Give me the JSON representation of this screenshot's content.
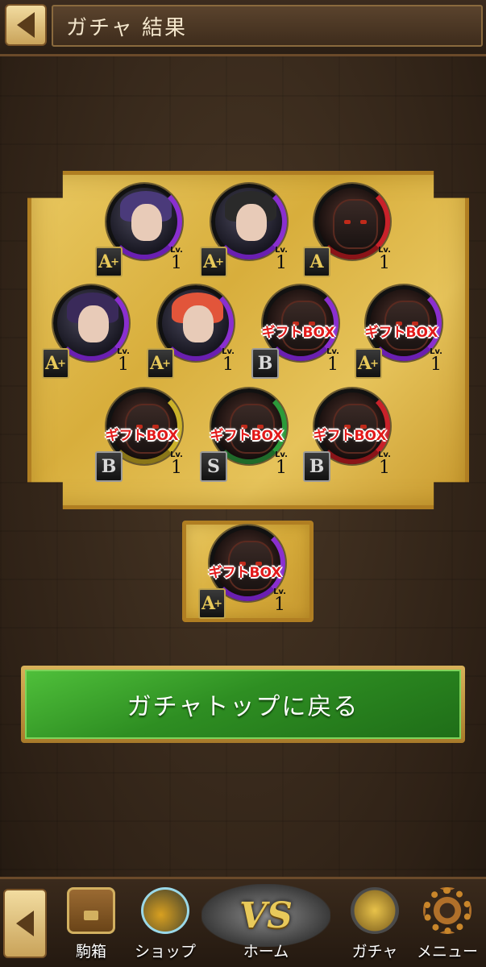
{
  "header": {
    "title": "ガチャ 結果"
  },
  "results": [
    {
      "rank": "A",
      "plus": "+",
      "lv_label": "Lv.",
      "level": "1",
      "gift": "",
      "ring": "purple",
      "kind": "character",
      "hair": "#4a3a7a"
    },
    {
      "rank": "A",
      "plus": "+",
      "lv_label": "Lv.",
      "level": "1",
      "gift": "",
      "ring": "purple",
      "kind": "character",
      "hair": "#2a2a2a"
    },
    {
      "rank": "A",
      "plus": "",
      "lv_label": "Lv.",
      "level": "1",
      "gift": "",
      "ring": "red",
      "kind": "monster"
    },
    {
      "rank": "A",
      "plus": "+",
      "lv_label": "Lv.",
      "level": "1",
      "gift": "",
      "ring": "purple",
      "kind": "character",
      "hair": "#3a2a5a"
    },
    {
      "rank": "A",
      "plus": "+",
      "lv_label": "Lv.",
      "level": "1",
      "gift": "",
      "ring": "purple",
      "kind": "character",
      "hair": "#e2553a"
    },
    {
      "rank": "B",
      "plus": "",
      "lv_label": "Lv.",
      "level": "1",
      "gift": "ギフトBOX",
      "ring": "purple",
      "kind": "monster"
    },
    {
      "rank": "A",
      "plus": "+",
      "lv_label": "Lv.",
      "level": "1",
      "gift": "ギフトBOX",
      "ring": "purple",
      "kind": "monster"
    },
    {
      "rank": "B",
      "plus": "",
      "lv_label": "Lv.",
      "level": "1",
      "gift": "ギフトBOX",
      "ring": "yellow",
      "kind": "monster"
    },
    {
      "rank": "S",
      "plus": "",
      "lv_label": "Lv.",
      "level": "1",
      "gift": "ギフトBOX",
      "ring": "green",
      "kind": "monster"
    },
    {
      "rank": "B",
      "plus": "",
      "lv_label": "Lv.",
      "level": "1",
      "gift": "ギフトBOX",
      "ring": "red",
      "kind": "monster"
    },
    {
      "rank": "A",
      "plus": "+",
      "lv_label": "Lv.",
      "level": "1",
      "gift": "ギフトBOX",
      "ring": "purple",
      "kind": "monster"
    }
  ],
  "return_button": {
    "label": "ガチャトップに戻る"
  },
  "nav": {
    "items": [
      {
        "label": "駒箱",
        "icon": "chest-icon"
      },
      {
        "label": "ショップ",
        "icon": "shop-icon"
      },
      {
        "label": "ホーム",
        "icon": "vs-icon",
        "badge": "VS"
      },
      {
        "label": "ガチャ",
        "icon": "gacha-coins-icon"
      },
      {
        "label": "メニュー",
        "icon": "gear-icon"
      }
    ]
  },
  "colors": {
    "board_gold": "#e2bb4e",
    "button_green": "#2e8e22",
    "gift_red": "#e21a1a"
  }
}
